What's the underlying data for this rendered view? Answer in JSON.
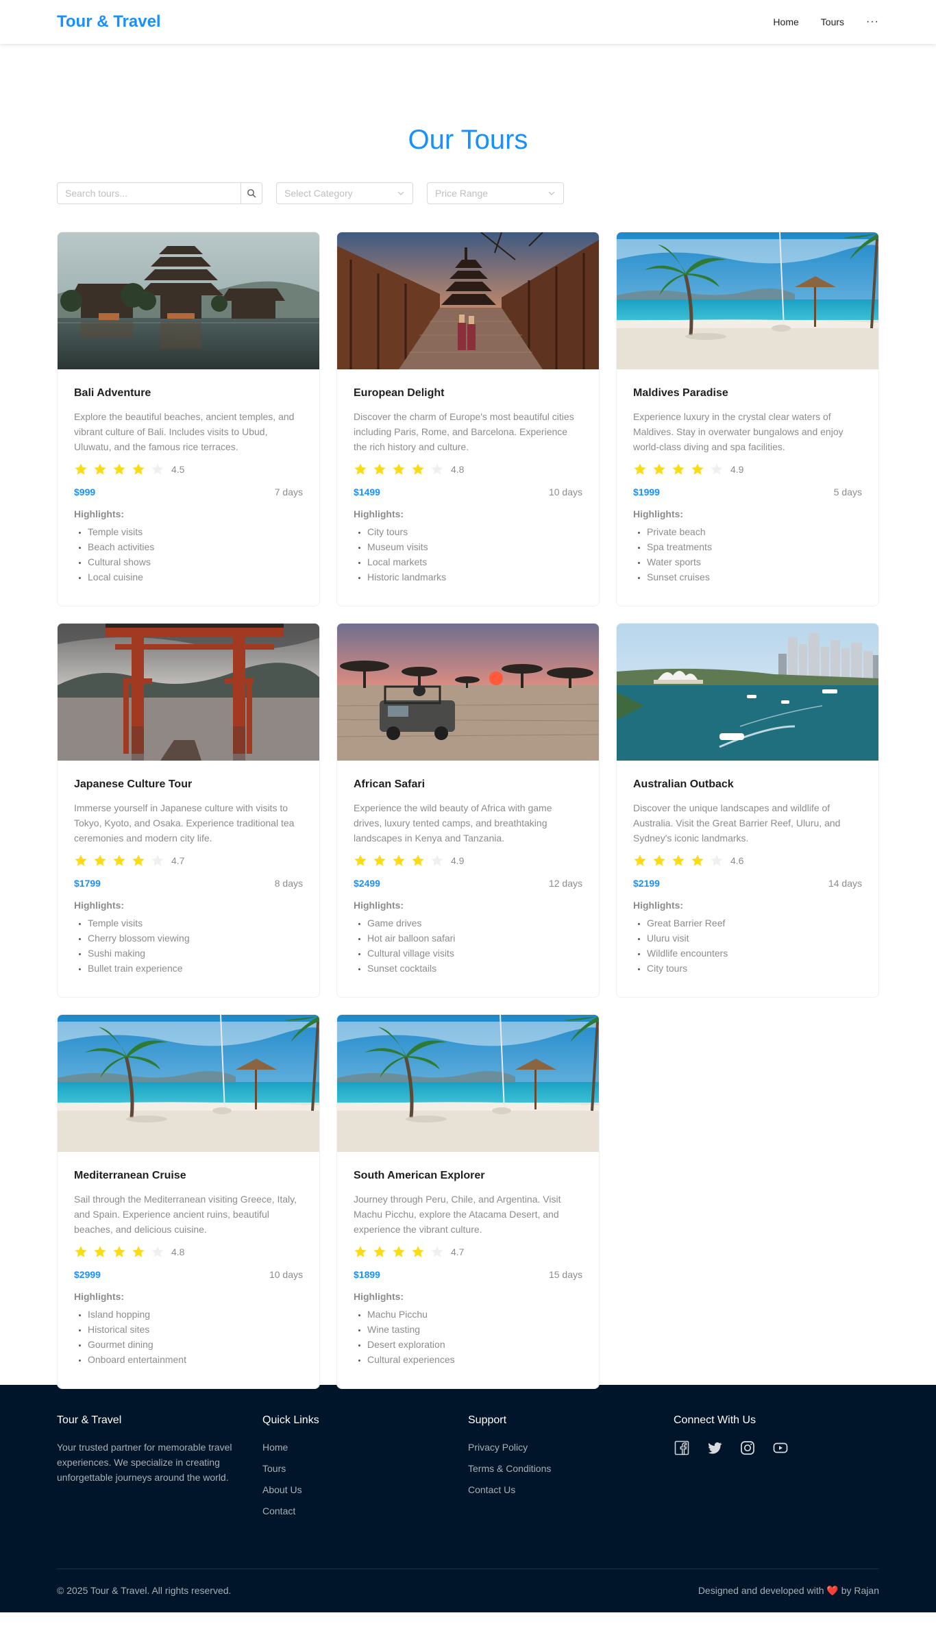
{
  "header": {
    "brand": "Tour & Travel",
    "nav": [
      "Home",
      "Tours"
    ],
    "more": "···"
  },
  "page": {
    "title": "Our Tours",
    "search_placeholder": "Search tours...",
    "category_placeholder": "Select Category",
    "price_placeholder": "Price Range"
  },
  "tours": [
    {
      "title": "Bali Adventure",
      "description": "Explore the beautiful beaches, ancient temples, and vibrant culture of Bali. Includes visits to Ubud, Uluwatu, and the famous rice terraces.",
      "rating": 4.5,
      "rating_label": "4.5",
      "price": "$999",
      "duration": "7 days",
      "highlights_label": "Highlights:",
      "highlights": [
        "Temple visits",
        "Beach activities",
        "Cultural shows",
        "Local cuisine"
      ],
      "image": "temple-lake"
    },
    {
      "title": "European Delight",
      "description": "Discover the charm of Europe's most beautiful cities including Paris, Rome, and Barcelona. Experience the rich history and culture.",
      "rating": 4.8,
      "rating_label": "4.8",
      "price": "$1499",
      "duration": "10 days",
      "highlights_label": "Highlights:",
      "highlights": [
        "City tours",
        "Museum visits",
        "Local markets",
        "Historic landmarks"
      ],
      "image": "old-street-pagoda"
    },
    {
      "title": "Maldives Paradise",
      "description": "Experience luxury in the crystal clear waters of Maldives. Stay in overwater bungalows and enjoy world-class diving and spa facilities.",
      "rating": 4.9,
      "rating_label": "4.9",
      "price": "$1999",
      "duration": "5 days",
      "highlights_label": "Highlights:",
      "highlights": [
        "Private beach",
        "Spa treatments",
        "Water sports",
        "Sunset cruises"
      ],
      "image": "tropical-beach"
    },
    {
      "title": "Japanese Culture Tour",
      "description": "Immerse yourself in Japanese culture with visits to Tokyo, Kyoto, and Osaka. Experience traditional tea ceremonies and modern city life.",
      "rating": 4.7,
      "rating_label": "4.7",
      "price": "$1799",
      "duration": "8 days",
      "highlights_label": "Highlights:",
      "highlights": [
        "Temple visits",
        "Cherry blossom viewing",
        "Sushi making",
        "Bullet train experience"
      ],
      "image": "torii-gate"
    },
    {
      "title": "African Safari",
      "description": "Experience the wild beauty of Africa with game drives, luxury tented camps, and breathtaking landscapes in Kenya and Tanzania.",
      "rating": 4.9,
      "rating_label": "4.9",
      "price": "$2499",
      "duration": "12 days",
      "highlights_label": "Highlights:",
      "highlights": [
        "Game drives",
        "Hot air balloon safari",
        "Cultural village visits",
        "Sunset cocktails"
      ],
      "image": "savanna-sunset"
    },
    {
      "title": "Australian Outback",
      "description": "Discover the unique landscapes and wildlife of Australia. Visit the Great Barrier Reef, Uluru, and Sydney's iconic landmarks.",
      "rating": 4.6,
      "rating_label": "4.6",
      "price": "$2199",
      "duration": "14 days",
      "highlights_label": "Highlights:",
      "highlights": [
        "Great Barrier Reef",
        "Uluru visit",
        "Wildlife encounters",
        "City tours"
      ],
      "image": "harbour-city"
    },
    {
      "title": "Mediterranean Cruise",
      "description": "Sail through the Mediterranean visiting Greece, Italy, and Spain. Experience ancient ruins, beautiful beaches, and delicious cuisine.",
      "rating": 4.8,
      "rating_label": "4.8",
      "price": "$2999",
      "duration": "10 days",
      "highlights_label": "Highlights:",
      "highlights": [
        "Island hopping",
        "Historical sites",
        "Gourmet dining",
        "Onboard entertainment"
      ],
      "image": "tropical-beach"
    },
    {
      "title": "South American Explorer",
      "description": "Journey through Peru, Chile, and Argentina. Visit Machu Picchu, explore the Atacama Desert, and experience the vibrant culture.",
      "rating": 4.7,
      "rating_label": "4.7",
      "price": "$1899",
      "duration": "15 days",
      "highlights_label": "Highlights:",
      "highlights": [
        "Machu Picchu",
        "Wine tasting",
        "Desert exploration",
        "Cultural experiences"
      ],
      "image": "tropical-beach"
    }
  ],
  "footer": {
    "about": {
      "heading": "Tour & Travel",
      "text": "Your trusted partner for memorable travel experiences. We specialize in creating unforgettable journeys around the world."
    },
    "quick_links": {
      "heading": "Quick Links",
      "links": [
        "Home",
        "Tours",
        "About Us",
        "Contact"
      ]
    },
    "support": {
      "heading": "Support",
      "links": [
        "Privacy Policy",
        "Terms & Conditions",
        "Contact Us"
      ]
    },
    "connect": {
      "heading": "Connect With Us",
      "icons": [
        "facebook-icon",
        "twitter-icon",
        "instagram-icon",
        "youtube-icon"
      ]
    },
    "copyright": "© 2025 Tour & Travel. All rights reserved.",
    "credit_prefix": "Designed and developed with",
    "credit_suffix": "by Rajan"
  },
  "colors": {
    "primary": "#1890ff",
    "star": "#fadb14",
    "star_empty": "#f0f0f0",
    "footer_bg": "#001529"
  }
}
